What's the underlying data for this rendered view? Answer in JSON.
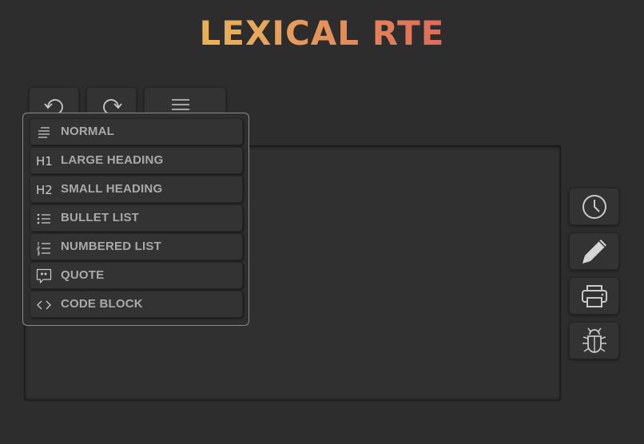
{
  "app": {
    "title": "LEXICAL RTE",
    "title_gradient": [
      "#e9d24a",
      "#e8a85a",
      "#e0685a",
      "#d44a68"
    ]
  },
  "toolbar": {
    "undo_icon": "undo-icon",
    "redo_icon": "redo-icon",
    "block_format_icon": "paragraph-icon"
  },
  "block_format_menu": {
    "items": [
      {
        "icon": "paragraph-icon",
        "label": "NORMAL"
      },
      {
        "icon": "h1-icon",
        "icon_text": "H1",
        "label": "LARGE HEADING"
      },
      {
        "icon": "h2-icon",
        "icon_text": "H2",
        "label": "SMALL HEADING"
      },
      {
        "icon": "bullet-list-icon",
        "label": "BULLET LIST"
      },
      {
        "icon": "numbered-list-icon",
        "label": "NUMBERED LIST"
      },
      {
        "icon": "quote-icon",
        "label": "QUOTE"
      },
      {
        "icon": "code-icon",
        "label": "CODE BLOCK"
      }
    ]
  },
  "actions": {
    "icons": [
      "clock-icon",
      "pencil-icon",
      "printer-icon",
      "bug-icon"
    ]
  },
  "colors": {
    "background": "#2d2d2d",
    "button": "#333333",
    "label": "#a9a9a9",
    "icon": "#c9c9c9",
    "dropdown_border": "#8a8a8a"
  }
}
